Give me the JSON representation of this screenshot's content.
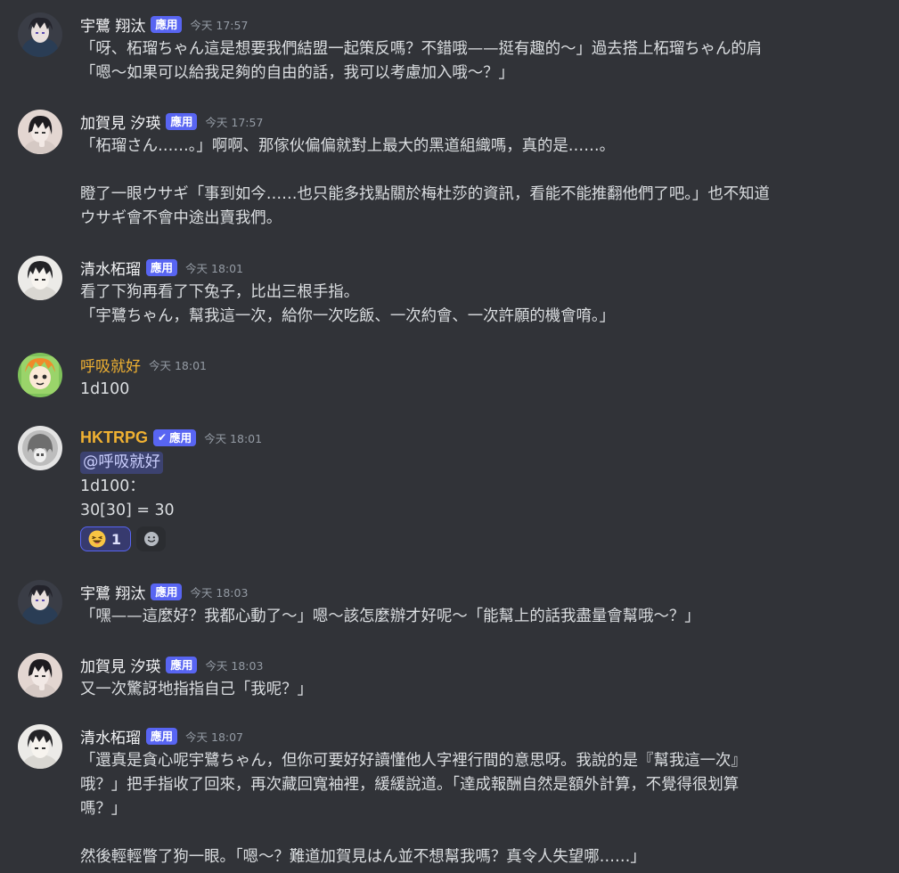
{
  "messages": [
    {
      "username": "宇鷺 翔汰",
      "badge": "應用",
      "timestamp": "今天 17:57",
      "lines": [
        "「呀、柘瑠ちゃん這是想要我們結盟一起策反嗎？不錯哦——挺有趣的～」過去搭上柘瑠ちゃん的肩",
        "「嗯～如果可以給我足夠的自由的話，我可以考慮加入哦～？」"
      ]
    },
    {
      "username": "加賀見 汐瑛",
      "badge": "應用",
      "timestamp": "今天 17:57",
      "lines": [
        "「柘瑠さん……。」啊啊、那傢伙偏偏就對上最大的黑道組織嗎，真的是……。",
        "",
        "瞪了一眼ウサギ「事到如今……也只能多找點關於梅杜莎的資訊，看能不能推翻他們了吧。」也不知道",
        "ウサギ會不會中途出賣我們。"
      ]
    },
    {
      "username": "清水柘瑠",
      "badge": "應用",
      "timestamp": "今天 18:01",
      "lines": [
        "看了下狗再看了下兔子，比出三根手指。",
        "「宇鷺ちゃん，幫我這一次，給你一次吃飯、一次約會、一次許願的機會唷。」"
      ]
    },
    {
      "username": "呼吸就好",
      "timestamp": "今天 18:01",
      "lines": [
        "1d100"
      ]
    },
    {
      "username": "HKTRPG",
      "badge": "應用",
      "timestamp": "今天 18:01",
      "mention": "@呼吸就好",
      "lines": [
        "1d100：",
        "30[30] = 30"
      ],
      "reaction": {
        "emoji": "😆",
        "count": "1"
      }
    },
    {
      "username": "宇鷺 翔汰",
      "badge": "應用",
      "timestamp": "今天 18:03",
      "lines": [
        "「嘿——這麼好？我都心動了～」嗯～該怎麼辦才好呢～「能幫上的話我盡量會幫哦～？」"
      ]
    },
    {
      "username": "加賀見 汐瑛",
      "badge": "應用",
      "timestamp": "今天 18:03",
      "lines": [
        "又一次驚訝地指指自己「我呢？」"
      ]
    },
    {
      "username": "清水柘瑠",
      "badge": "應用",
      "timestamp": "今天 18:07",
      "lines": [
        "「還真是貪心呢宇鷺ちゃん，但你可要好好讀懂他人字裡行間的意思呀。我說的是『幫我這一次』",
        "哦？」把手指收了回來，再次藏回寬袖裡，緩緩說道。「達成報酬自然是額外計算，不覺得很划算",
        "嗎？」",
        "",
        "然後輕輕瞥了狗一眼。「嗯～？難道加賀見はん並不想幫我嗎？真令人失望哪……」"
      ]
    }
  ],
  "colors": {
    "background": "#313338",
    "username": "#f2f3f5",
    "username_special": "#f0b132",
    "badge": "#5865f2",
    "timestamp": "#949ba4",
    "text": "#dbdee1",
    "mention_bg": "#3c4270",
    "mention_text": "#c9cdfb"
  }
}
